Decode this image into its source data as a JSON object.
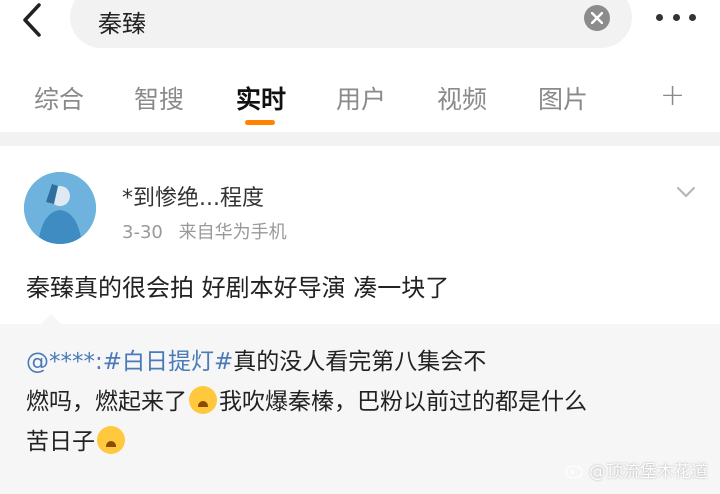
{
  "search": {
    "query": "秦臻"
  },
  "tabs": [
    {
      "label": "综合"
    },
    {
      "label": "智搜"
    },
    {
      "label": "实时"
    },
    {
      "label": "用户"
    },
    {
      "label": "视频"
    },
    {
      "label": "图片"
    }
  ],
  "tabs_plus": "+",
  "post": {
    "author": "*到惨绝...程度",
    "date": "3-30",
    "source_prefix": "来自",
    "source_device": "华为手机",
    "text": "秦臻真的很会拍 好剧本好导演 凑一块了",
    "quote": {
      "mention": "@****:",
      "hashtag": "#白日提灯#",
      "line1_rest": "真的没人看完第八集会不",
      "line2a": "燃吗，燃起来了",
      "line2b": "我吹爆秦榛，巴粉以前过的都是什么",
      "line3": "苦日子"
    }
  },
  "watermark": "@顶流堡木花道",
  "colors": {
    "accent": "#ff8200",
    "link": "#4a7ab9"
  }
}
